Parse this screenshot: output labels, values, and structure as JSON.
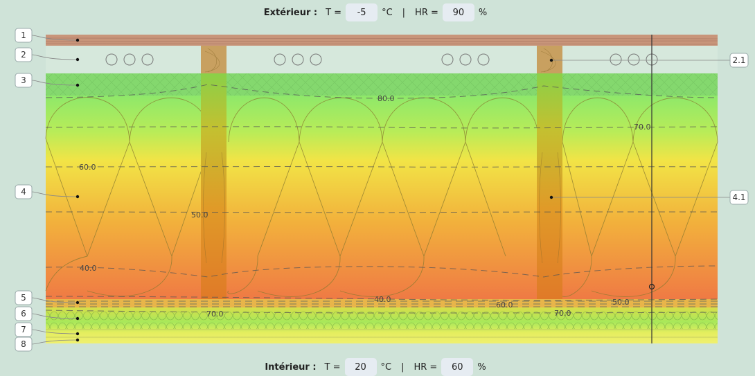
{
  "exterior": {
    "label": "Extérieur :",
    "t_label": "T =",
    "t_value": "-5",
    "t_unit": "°C",
    "sep": "|",
    "hr_label": "HR =",
    "hr_value": "90",
    "hr_unit": "%"
  },
  "interior": {
    "label": "Intérieur :",
    "t_label": "T =",
    "t_value": "20",
    "t_unit": "°C",
    "sep": "|",
    "hr_label": "HR =",
    "hr_value": "60",
    "hr_unit": "%"
  },
  "layer_tags": [
    "1",
    "2",
    "3",
    "4",
    "5",
    "6",
    "7",
    "8"
  ],
  "stud_tags": [
    "2.1",
    "4.1"
  ],
  "isolines": [
    "80.0",
    "70.0",
    "60.0",
    "50.0",
    "40.0",
    "40.0",
    "60.0",
    "50.0",
    "70.0",
    "70.0"
  ],
  "colors": {
    "background": "#cfe3d8",
    "wood": "#c8957a",
    "humid": "#7fd86a",
    "dry": "#f07d44",
    "insulation_mid": "#f0d438"
  }
}
